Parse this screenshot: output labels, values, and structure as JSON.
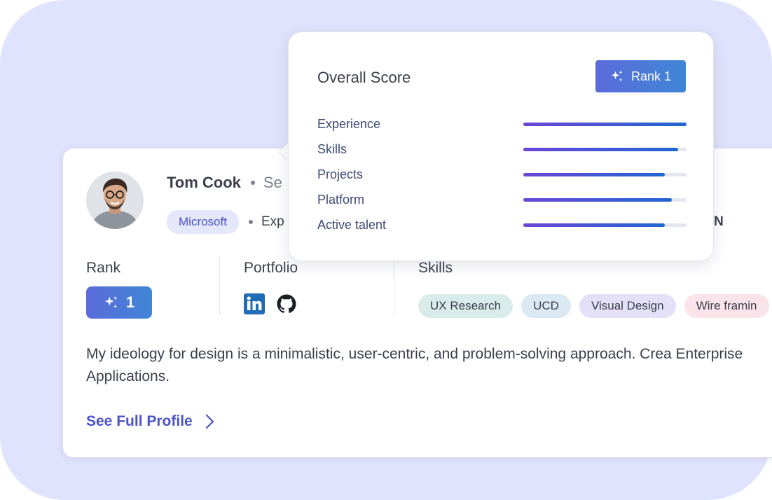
{
  "profile": {
    "name": "Tom Cook",
    "role_partial": "Se",
    "company": "Microsoft",
    "meta_partial": "Exp",
    "meta_tail": "N",
    "rank_label": "Rank",
    "rank_value": "1",
    "portfolio_label": "Portfolio",
    "portfolio_icons": [
      "linkedin-icon",
      "github-icon"
    ],
    "skills_label": "Skills",
    "skills": [
      {
        "label": "UX Research",
        "color": "#daece9"
      },
      {
        "label": "UCD",
        "color": "#dbeaf2"
      },
      {
        "label": "Visual Design",
        "color": "#e3e0f7"
      },
      {
        "label": "Wire framin",
        "color": "#fbe3ea"
      }
    ],
    "bio": "My ideology for design is a minimalistic, user-centric, and problem-solving approach. Crea Enterprise Applications.",
    "full_profile_link": "See Full Profile"
  },
  "score_popover": {
    "title": "Overall Score",
    "rank_button": "Rank 1",
    "rows": [
      {
        "label": "Experience",
        "value": 1.0
      },
      {
        "label": "Skills",
        "value": 0.95
      },
      {
        "label": "Projects",
        "value": 0.865
      },
      {
        "label": "Platform",
        "value": 0.91
      },
      {
        "label": "Active talent",
        "value": 0.865
      }
    ]
  },
  "colors": {
    "background": "#e0e3fd",
    "accent": "#4b53c9",
    "badge_gradient_start": "#5b6bdb",
    "badge_gradient_end": "#3f86d6"
  }
}
